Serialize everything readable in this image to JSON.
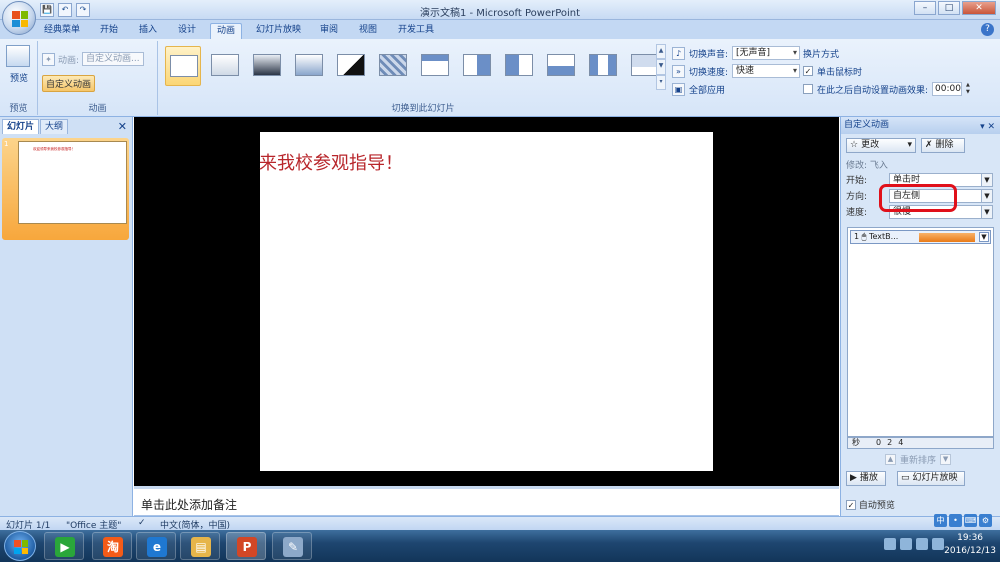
{
  "window": {
    "title": "演示文稿1 - Microsoft PowerPoint"
  },
  "qat": {
    "save": "💾",
    "undo": "↶",
    "redo": "↷"
  },
  "ribbon_tabs": [
    "经典菜单",
    "开始",
    "插入",
    "设计",
    "动画",
    "幻灯片放映",
    "审阅",
    "视图",
    "开发工具"
  ],
  "active_tab": "动画",
  "preview_group": {
    "button": "预览",
    "label": "预览"
  },
  "animation_group": {
    "animation_label": "动画:",
    "animation_value": "自定义动画...",
    "custom_button": "自定义动画",
    "label": "动画"
  },
  "transition_group": {
    "label": "切换到此幻灯片",
    "sound_label": "切换声音:",
    "sound_value": "[无声音]",
    "speed_label": "切换速度:",
    "speed_value": "快速",
    "apply_all": "全部应用"
  },
  "advance_group": {
    "title": "换片方式",
    "on_click": "单击鼠标时",
    "on_click_checked": true,
    "after_time": "在此之后自动设置动画效果:",
    "after_time_checked": false,
    "time_value": "00:00"
  },
  "slides_panel": {
    "tabs": [
      "幻灯片",
      "大纲"
    ],
    "slide_number": "1",
    "thumb_text": "欢迎领导来我校参观指导！"
  },
  "slide": {
    "text": "来我校参观指导！"
  },
  "notes": {
    "placeholder": "单击此处添加备注"
  },
  "anim_pane": {
    "title": "自定义动画",
    "change_button": "更改",
    "delete_button": "删除",
    "modify": "修改: 飞入",
    "start_label": "开始:",
    "start_value": "单击时",
    "direction_label": "方向:",
    "direction_value": "自左侧",
    "speed_label": "速度:",
    "speed_value": "很慢",
    "item": {
      "index": "1",
      "name": "TextB..."
    },
    "timeline": {
      "unit": "秒",
      "ticks": [
        "0",
        "2",
        "4"
      ]
    },
    "reorder": "重新排序",
    "play_button": "播放",
    "slideshow_button": "幻灯片放映",
    "autopreview": "自动预览"
  },
  "statusbar": {
    "slide": "幻灯片 1/1",
    "theme": "\"Office 主题\"",
    "language": "中文(简体，中国)"
  },
  "taskbar": {
    "time": "19:36",
    "date": "2016/12/13"
  },
  "colors": {
    "accent": "#15428b",
    "highlight_ring": "#e0101a",
    "slide_text": "#b8262b",
    "anim_bar": "#e97b19"
  }
}
